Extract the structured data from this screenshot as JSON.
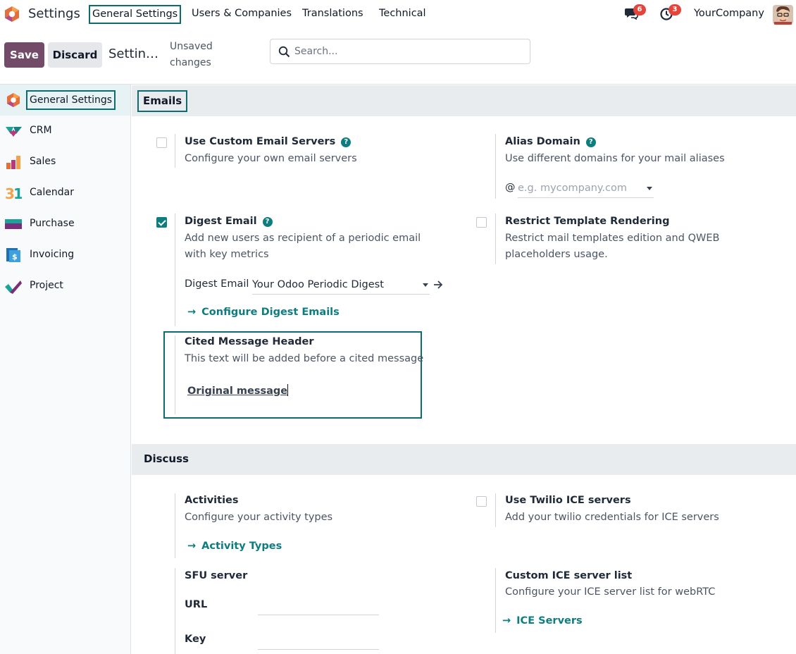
{
  "navbar": {
    "app_name": "Settings",
    "menus": [
      "General Settings",
      "Users & Companies",
      "Translations",
      "Technical"
    ],
    "messages_count": "6",
    "activities_count": "3",
    "company": "YourCompany"
  },
  "control_panel": {
    "save_label": "Save",
    "discard_label": "Discard",
    "breadcrumb": "Settin…",
    "unsaved": "Unsaved changes",
    "search_placeholder": "Search..."
  },
  "sidebar": {
    "items": [
      {
        "label": "General Settings",
        "icon": "settings-app-icon"
      },
      {
        "label": "CRM",
        "icon": "crm-app-icon"
      },
      {
        "label": "Sales",
        "icon": "sales-app-icon"
      },
      {
        "label": "Calendar",
        "icon": "calendar-app-icon"
      },
      {
        "label": "Purchase",
        "icon": "purchase-app-icon"
      },
      {
        "label": "Invoicing",
        "icon": "invoicing-app-icon"
      },
      {
        "label": "Project",
        "icon": "project-app-icon"
      }
    ]
  },
  "emails": {
    "title": "Emails",
    "custom_servers": {
      "title": "Use Custom Email Servers",
      "desc": "Configure your own email servers",
      "checked": false
    },
    "alias_domain": {
      "title": "Alias Domain",
      "desc": "Use different domains for your mail aliases",
      "at": "@",
      "placeholder": "e.g. mycompany.com"
    },
    "digest": {
      "title": "Digest Email",
      "desc": "Add new users as recipient of a periodic email with key metrics",
      "checked": true,
      "field_label": "Digest Email",
      "field_value": "Your Odoo Periodic Digest",
      "link": "Configure Digest Emails"
    },
    "restrict_template": {
      "title": "Restrict Template Rendering",
      "desc": "Restrict mail templates edition and QWEB placeholders usage.",
      "checked": false
    },
    "cited_header": {
      "title": "Cited Message Header",
      "desc": "This text will be added before a cited message",
      "value": "Original message"
    }
  },
  "discuss": {
    "title": "Discuss",
    "activities": {
      "title": "Activities",
      "desc": "Configure your activity types",
      "link": "Activity Types"
    },
    "twilio": {
      "title": "Use Twilio ICE servers",
      "desc": "Add your twilio credentials for ICE servers",
      "checked": false
    },
    "sfu": {
      "title": "SFU server",
      "url_label": "URL",
      "key_label": "Key"
    },
    "ice_list": {
      "title": "Custom ICE server list",
      "desc": "Configure your ICE server list for webRTC",
      "link": "ICE Servers"
    }
  },
  "colors": {
    "brand": "#714b67",
    "accent": "#0e7d7f",
    "badge": "#e6433a"
  }
}
